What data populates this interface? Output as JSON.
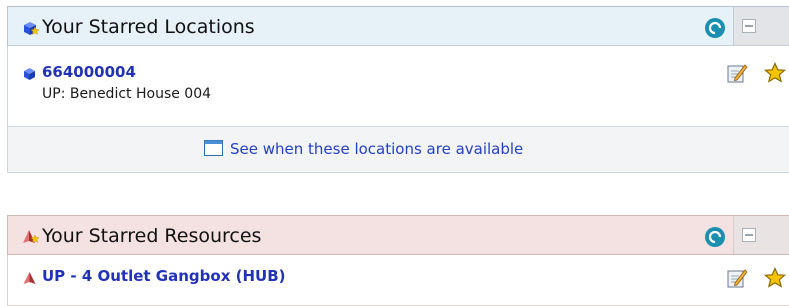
{
  "locations": {
    "title": "Your Starred Locations",
    "header_icon": "box-star-icon",
    "action_icon": "refresh-circle-icon",
    "collapse_icon": "collapse-minus-icon",
    "items": [
      {
        "id": "664000004",
        "subtitle": "UP: Benedict House 004",
        "icon": "blue-cube-icon"
      }
    ],
    "footer_link": "See when these locations are available",
    "footer_icon": "calendar-icon"
  },
  "resources": {
    "title": "Your Starred Resources",
    "header_icon": "pyramid-star-icon",
    "action_icon": "refresh-circle-icon",
    "collapse_icon": "collapse-minus-icon",
    "items": [
      {
        "id": "UP - 4 Outlet Gangbox (HUB)",
        "icon": "red-pyramid-icon"
      }
    ]
  },
  "colors": {
    "locations_header_bg": "#e7f1f8",
    "resources_header_bg": "#f4e1e1",
    "link_color": "#2232b8",
    "action_teal": "#1a8fb0",
    "star_yellow": "#f5c400"
  }
}
